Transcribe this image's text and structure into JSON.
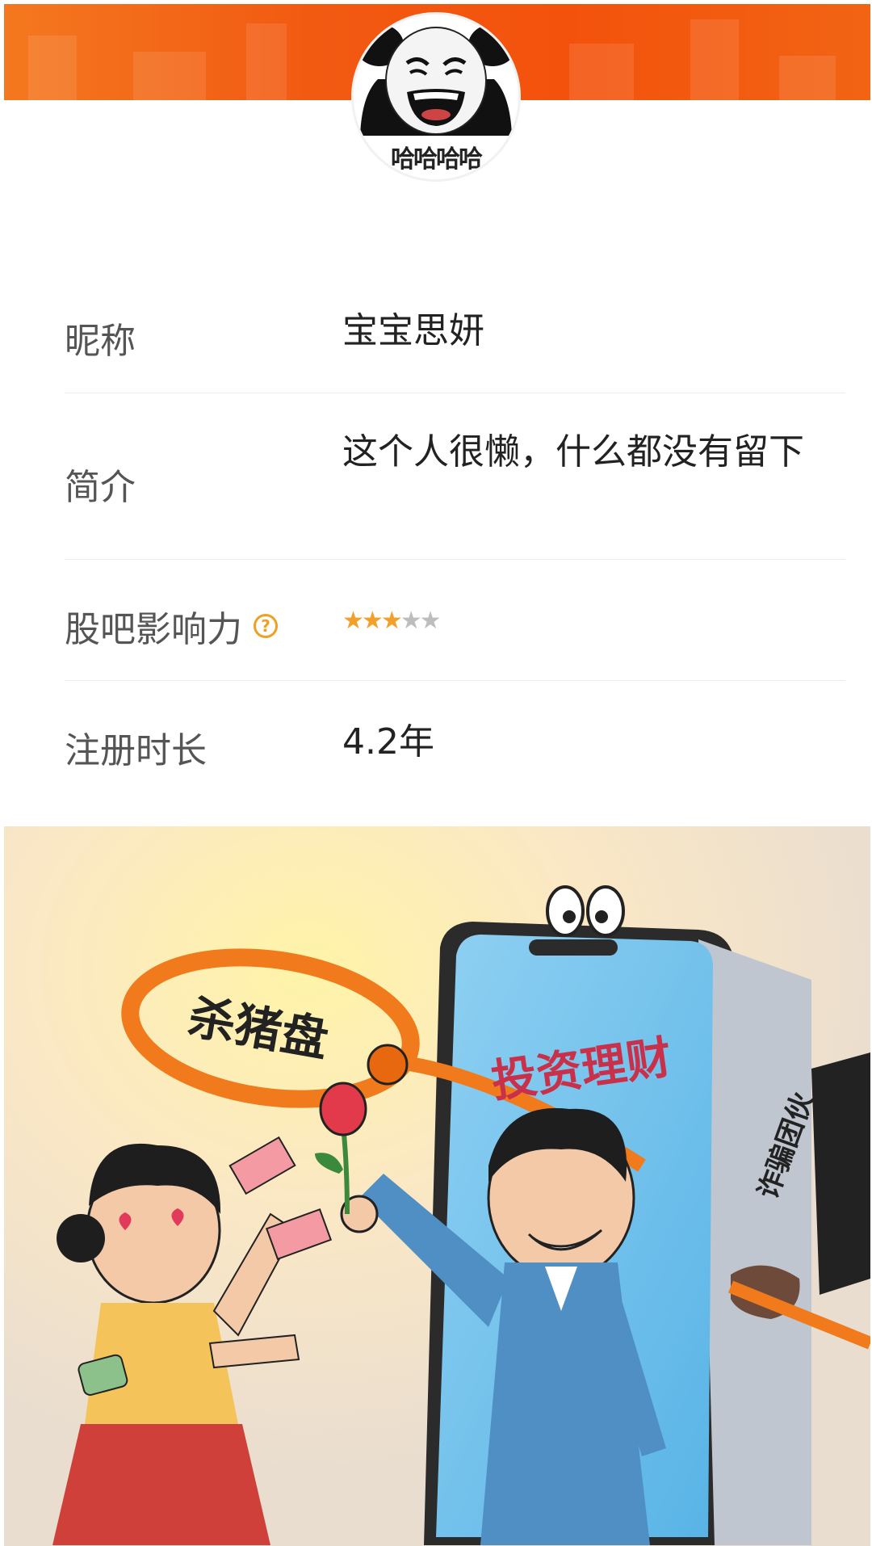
{
  "profile": {
    "avatar_caption": "哈哈哈哈",
    "nickname_label": "昵称",
    "nickname_value": "宝宝思妍",
    "bio_label": "简介",
    "bio_value": "这个人很懒，什么都没有留下",
    "influence_label": "股吧影响力",
    "influence_help_icon": "?",
    "influence_rating": 3,
    "influence_max": 5,
    "register_label": "注册时长",
    "register_value": "4.2年"
  },
  "illustration": {
    "noose_label": "杀猪盘",
    "phone_label": "投资理财",
    "sleeve_label": "诈骗团伙"
  },
  "colors": {
    "banner": "#f25a12",
    "star_on": "#f3a02a",
    "star_off": "#bdbdbd",
    "help_icon": "#f0a020"
  }
}
